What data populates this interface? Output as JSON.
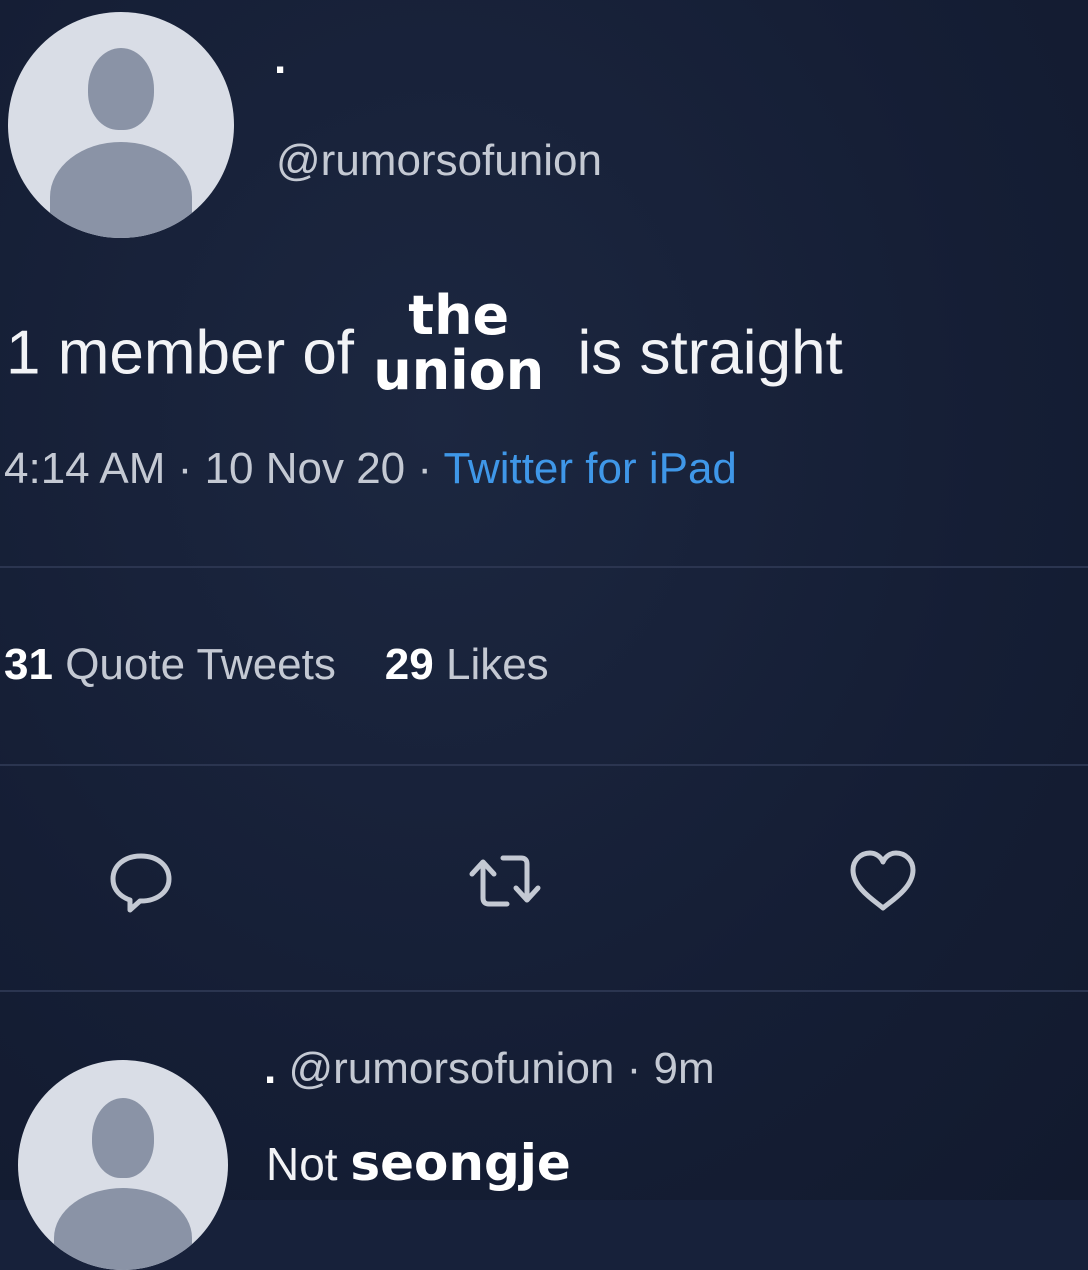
{
  "tweet": {
    "display_name": ".",
    "handle": "@rumorsofunion",
    "text_before": "1 member of",
    "text_overlay_line1": "the",
    "text_overlay_line2": "union",
    "text_after": "is straight",
    "time": "4:14 AM",
    "date": "10 Nov 20",
    "source": "Twitter for iPad",
    "sep": "·",
    "quote_count": "31",
    "quote_label": "Quote Tweets",
    "like_count": "29",
    "like_label": "Likes"
  },
  "actions": [
    {
      "icon": "reply-icon"
    },
    {
      "icon": "retweet-icon"
    },
    {
      "icon": "like-icon"
    }
  ],
  "reply": {
    "display_name": ".",
    "handle": "@rumorsofunion",
    "sep": "·",
    "age": "9m",
    "text": "Not",
    "text_overlay": "seongje"
  },
  "colors": {
    "background": "#17213a",
    "link": "#3f97e8",
    "muted_text": "#c4c9d3",
    "divider": "#2b3550",
    "avatar_bg": "#d9dde6",
    "avatar_fg": "#8a93a6"
  }
}
